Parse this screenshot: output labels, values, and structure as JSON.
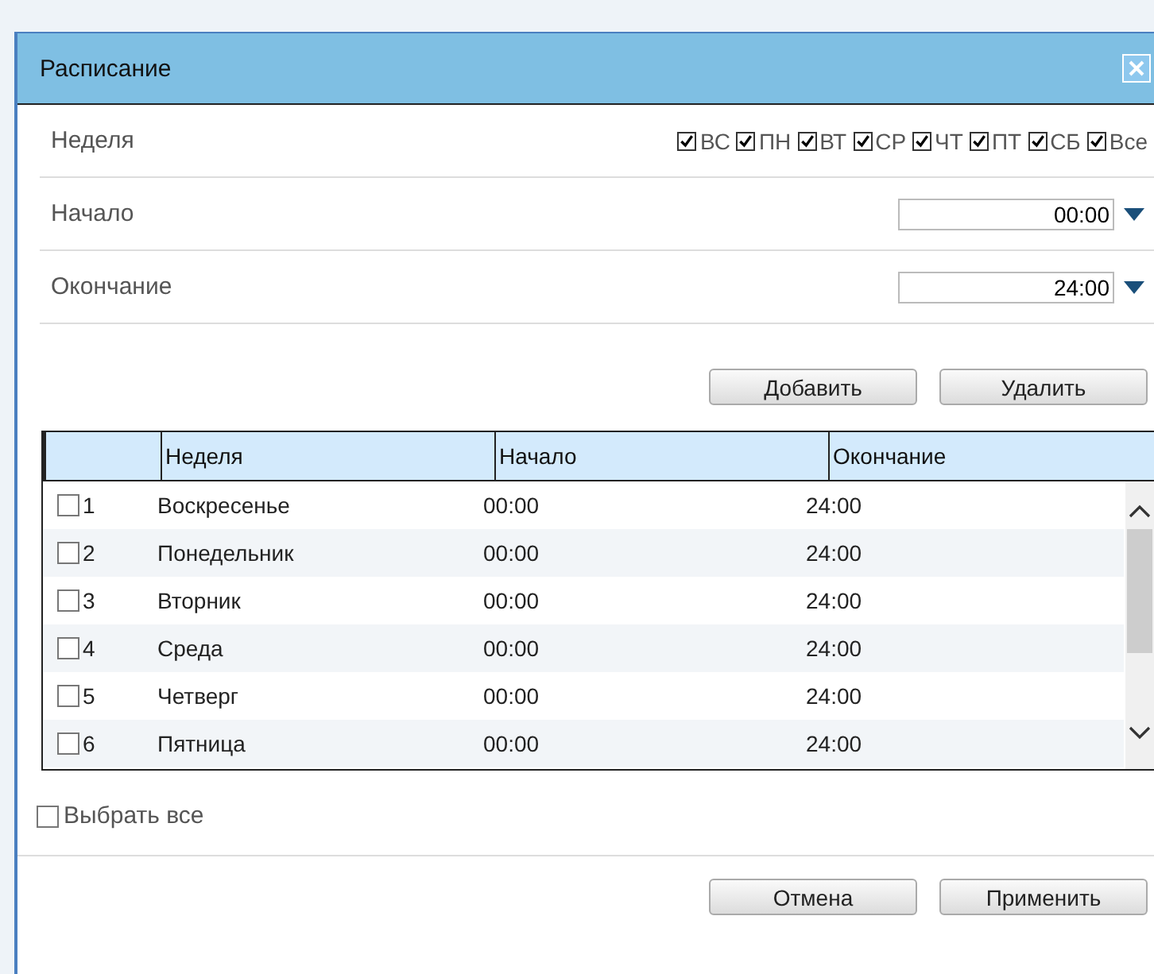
{
  "window": {
    "title": "Расписание"
  },
  "form": {
    "week_label": "Неделя",
    "days": [
      {
        "label": "ВС",
        "checked": true
      },
      {
        "label": "ПН",
        "checked": true
      },
      {
        "label": "ВТ",
        "checked": true
      },
      {
        "label": "СР",
        "checked": true
      },
      {
        "label": "ЧТ",
        "checked": true
      },
      {
        "label": "ПТ",
        "checked": true
      },
      {
        "label": "СБ",
        "checked": true
      },
      {
        "label": "Все",
        "checked": true
      }
    ],
    "start_label": "Начало",
    "start_value": "00:00",
    "end_label": "Окончание",
    "end_value": "24:00"
  },
  "action_buttons": [
    "Добавить",
    "Удалить"
  ],
  "table": {
    "columns": [
      "Неделя",
      "Начало",
      "Окончание"
    ],
    "rows": [
      {
        "index": "1",
        "checked": false,
        "day": "Воскресенье",
        "start": "00:00",
        "end": "24:00"
      },
      {
        "index": "2",
        "checked": false,
        "day": "Понедельник",
        "start": "00:00",
        "end": "24:00"
      },
      {
        "index": "3",
        "checked": false,
        "day": "Вторник",
        "start": "00:00",
        "end": "24:00"
      },
      {
        "index": "4",
        "checked": false,
        "day": "Среда",
        "start": "00:00",
        "end": "24:00"
      },
      {
        "index": "5",
        "checked": false,
        "day": "Четверг",
        "start": "00:00",
        "end": "24:00"
      },
      {
        "index": "6",
        "checked": false,
        "day": "Пятница",
        "start": "00:00",
        "end": "24:00"
      }
    ]
  },
  "select_all": {
    "label": "Выбрать все",
    "checked": false
  },
  "footer_buttons": [
    "Отмена",
    "Применить"
  ]
}
